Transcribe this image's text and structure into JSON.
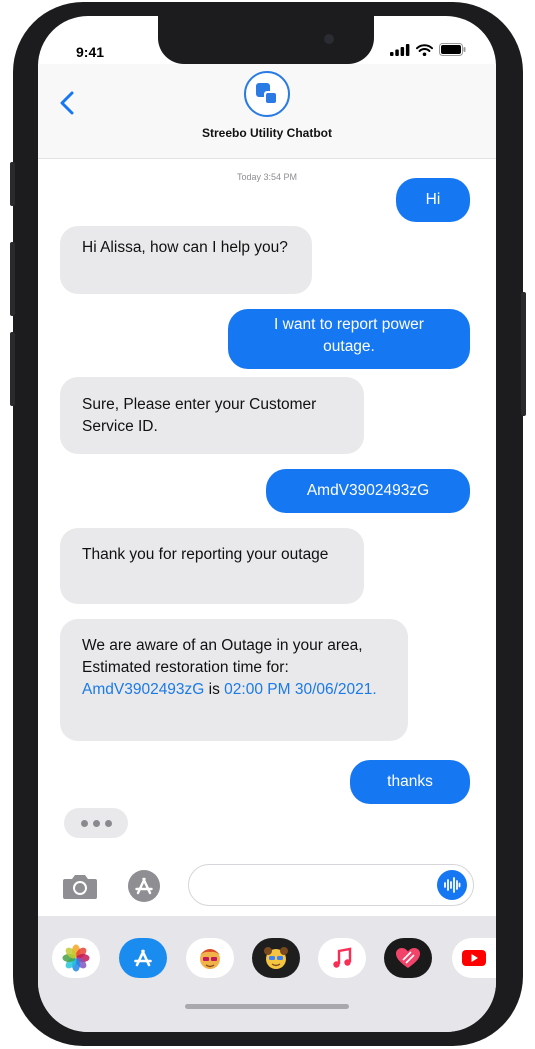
{
  "status_bar": {
    "time": "9:41"
  },
  "header": {
    "title": "Streebo Utility Chatbot"
  },
  "conversation": {
    "timestamp": "Today 3:54 PM",
    "messages": [
      {
        "from": "user",
        "text": "Hi"
      },
      {
        "from": "bot",
        "text": "Hi Alissa, how can I help you?"
      },
      {
        "from": "user",
        "text": "I want to report power outage."
      },
      {
        "from": "bot",
        "text": "Sure, Please enter your Customer Service ID."
      },
      {
        "from": "user",
        "text": "AmdV3902493zG"
      },
      {
        "from": "bot",
        "text": "Thank you for reporting your outage"
      },
      {
        "from": "bot",
        "parts": {
          "prefix": "We are aware of an Outage in your area, Estimated restoration time for:",
          "id_link": "AmdV3902493zG",
          "connector": " is ",
          "time_link": "02:00 PM 30/06/2021."
        }
      },
      {
        "from": "user",
        "text": "thanks"
      }
    ]
  },
  "input_bar": {
    "camera_icon": "camera-icon",
    "app_store_icon": "app-store-icon",
    "audio_icon": "audio-waveform-icon"
  },
  "app_tray": {
    "apps": [
      "photos-icon",
      "app-store-icon",
      "memoji-icon",
      "memoji-stickers-icon",
      "music-icon",
      "digital-touch-icon",
      "youtube-icon"
    ]
  },
  "colors": {
    "accent": "#1577f2",
    "incoming_bubble": "#e9e9eb",
    "link": "#1a7ae6"
  }
}
